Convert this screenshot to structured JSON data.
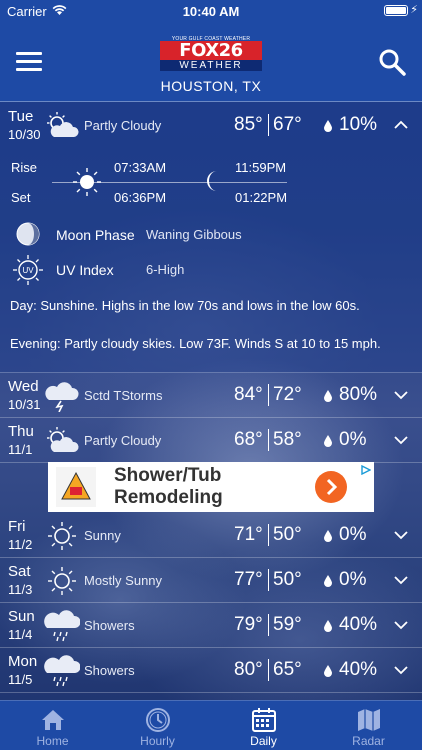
{
  "status_bar": {
    "carrier": "Carrier",
    "time": "10:40 AM"
  },
  "header": {
    "logo": {
      "tagline": "YOUR GULF COAST WEATHER AUTHORITY",
      "brand": "FOX26",
      "sub": "WEATHER"
    },
    "location": "HOUSTON, TX"
  },
  "expanded_day": {
    "dow": "Tue",
    "date": "10/30",
    "icon": "partly-cloudy-icon",
    "condition": "Partly Cloudy",
    "hi": "85°",
    "lo": "67°",
    "precip": "10%",
    "rise_label": "Rise",
    "set_label": "Set",
    "sunrise": "07:33AM",
    "sunset": "06:36PM",
    "moonrise": "11:59PM",
    "moonset": "01:22PM",
    "moon_phase_label": "Moon Phase",
    "moon_phase": "Waning Gibbous",
    "uv_label": "UV Index",
    "uv": "6-High",
    "day_label": "Day",
    "day_text": ": Sunshine. Highs in the low 70s and lows in the low 60s.",
    "evening_label": "Evening",
    "evening_text": ": Partly cloudy skies. Low 73F. Winds S at 10 to 15 mph."
  },
  "days": [
    {
      "dow": "Wed",
      "date": "10/31",
      "icon": "thunderstorm-icon",
      "condition": "Sctd TStorms",
      "hi": "84°",
      "lo": "72°",
      "precip": "80%"
    },
    {
      "dow": "Thu",
      "date": "11/1",
      "icon": "partly-cloudy-icon",
      "condition": "Partly Cloudy",
      "hi": "68°",
      "lo": "58°",
      "precip": "0%"
    },
    {
      "dow": "Fri",
      "date": "11/2",
      "icon": "sun-icon",
      "condition": "Sunny",
      "hi": "71°",
      "lo": "50°",
      "precip": "0%"
    },
    {
      "dow": "Sat",
      "date": "11/3",
      "icon": "sun-icon",
      "condition": "Mostly Sunny",
      "hi": "77°",
      "lo": "50°",
      "precip": "0%"
    },
    {
      "dow": "Sun",
      "date": "11/4",
      "icon": "showers-icon",
      "condition": "Showers",
      "hi": "79°",
      "lo": "59°",
      "precip": "40%"
    },
    {
      "dow": "Mon",
      "date": "11/5",
      "icon": "showers-icon",
      "condition": "Showers",
      "hi": "80°",
      "lo": "65°",
      "precip": "40%"
    }
  ],
  "ad": {
    "headline_line1": "Shower/Tub",
    "headline_line2": "Remodeling"
  },
  "tabs": [
    {
      "label": "Home",
      "icon": "home-icon"
    },
    {
      "label": "Hourly",
      "icon": "clock-icon"
    },
    {
      "label": "Daily",
      "icon": "calendar-icon",
      "active": true
    },
    {
      "label": "Radar",
      "icon": "map-icon"
    }
  ],
  "colors": {
    "header": "#1e4aa5",
    "ad_button": "#f26522",
    "logo_red": "#d8232a"
  }
}
